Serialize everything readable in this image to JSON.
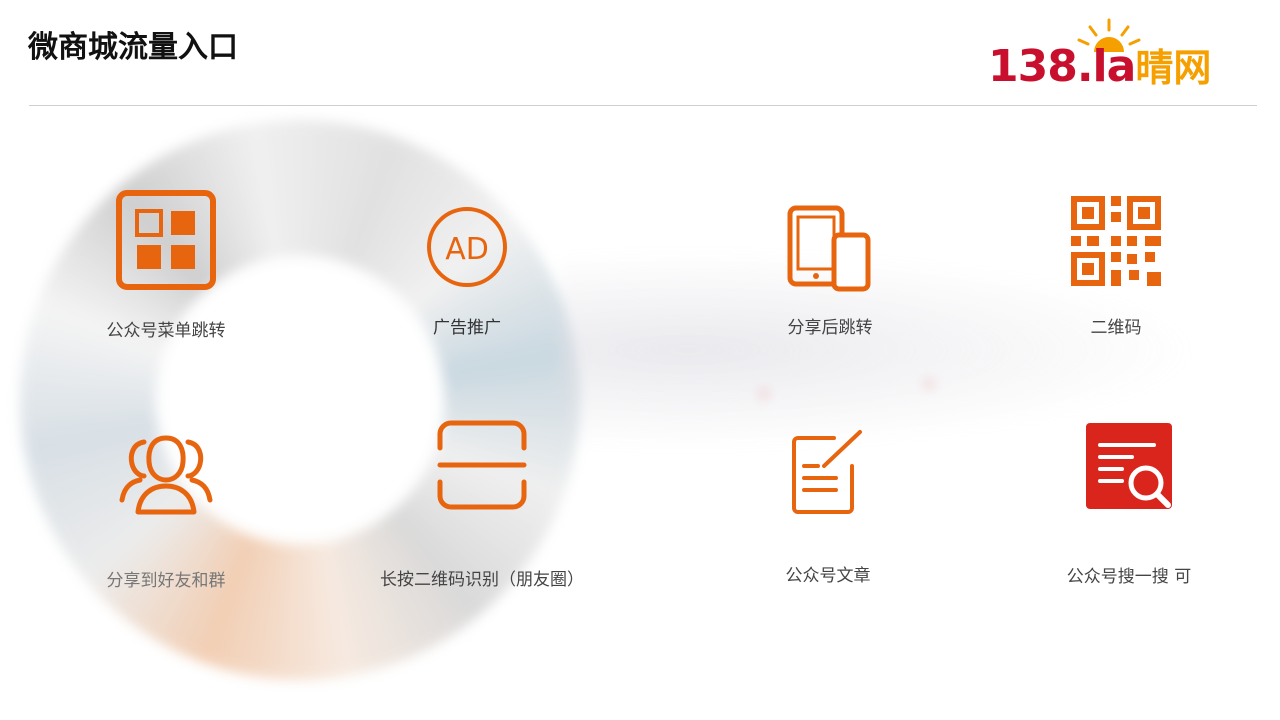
{
  "header": {
    "title": "微商城流量入口",
    "logo": {
      "number_text": "138.la",
      "chinese_text": "晴网",
      "red": "#c8102e",
      "orange": "#f5a000"
    }
  },
  "accent": "#e8650f",
  "tiles": [
    {
      "label": "公众号菜单跳转",
      "icon": "menu-grid-icon"
    },
    {
      "label": "广告推广",
      "icon": "ad-icon"
    },
    {
      "label": "分享后跳转",
      "icon": "devices-icon"
    },
    {
      "label": "二维码",
      "icon": "qr-code-icon"
    },
    {
      "label": "分享到好友和群",
      "icon": "group-users-icon"
    },
    {
      "label": "长按二维码识别（朋友圈）",
      "icon": "scan-icon"
    },
    {
      "label": "公众号文章",
      "icon": "edit-note-icon"
    },
    {
      "label": "公众号搜一搜 可",
      "icon": "search-doc-icon"
    }
  ]
}
